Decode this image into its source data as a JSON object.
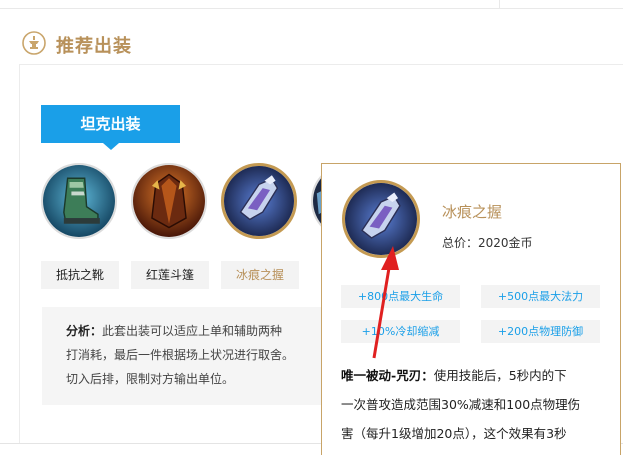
{
  "section": {
    "title": "推荐出装",
    "icon": "anvil-icon"
  },
  "tab": {
    "label": "坦克出装"
  },
  "items": [
    {
      "label": "抵抗之靴",
      "icon": "boots-icon",
      "selected": false
    },
    {
      "label": "红莲斗篷",
      "icon": "cloak-icon",
      "selected": false
    },
    {
      "label": "冰痕之握",
      "icon": "gauntlet-icon",
      "selected": true
    }
  ],
  "analysis": {
    "label": "分析：",
    "lines": [
      "此套出装可以适应上单和辅助两种",
      "打消耗，最后一件根据场上状况进行取舍。",
      "切入后排，限制对方输出单位。"
    ]
  },
  "popup": {
    "name": "冰痕之握",
    "price": "总价：2020金币",
    "stats": [
      "+800点最大生命",
      "+500点最大法力",
      "+10%冷却缩减",
      "+200点物理防御"
    ],
    "passive_label": "唯一被动-咒刃：",
    "passive_lines": [
      "使用技能后，5秒内的下",
      "一次普攻造成范围30%减速和100点物理伤",
      "害（每升1级增加20点），这个效果有3秒"
    ]
  },
  "colors": {
    "accent_gold": "#b8915a",
    "tab_blue": "#1a9fe8",
    "annotation_red": "#e02020"
  }
}
